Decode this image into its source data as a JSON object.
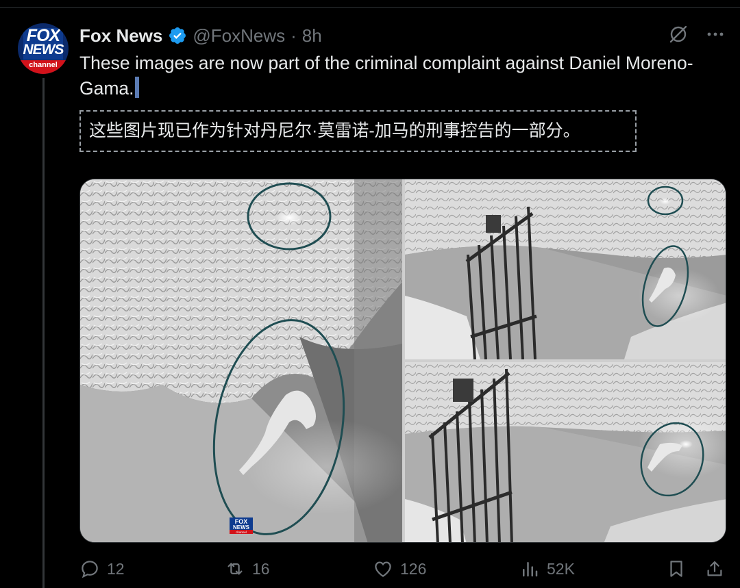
{
  "post": {
    "author_name": "Fox News",
    "handle": "@FoxNews",
    "separator": "·",
    "time": "8h",
    "text": "These images are now part of the criminal complaint against Daniel Moreno-Gama.",
    "translation": "这些图片现已作为针对丹尼尔·莫雷诺-加马的刑事控告的一部分。"
  },
  "avatar": {
    "logo_top": "FOX",
    "logo_bottom": "NEWS",
    "logo_band": "channel"
  },
  "media": {
    "watermark_top": "FOX",
    "watermark_bottom": "NEWS",
    "watermark_band": "channel"
  },
  "actions": {
    "replies": "12",
    "reposts": "16",
    "likes": "126",
    "views": "52K"
  },
  "icons": {
    "verified": "verified-badge-icon",
    "grok": "grok-icon",
    "more": "more-icon",
    "reply": "reply-icon",
    "repost": "repost-icon",
    "like": "like-icon",
    "views": "views-icon",
    "bookmark": "bookmark-icon",
    "share": "share-icon"
  },
  "colors": {
    "background": "#000000",
    "text": "#e7e9ea",
    "muted": "#71767b",
    "verified": "#1d9bf0",
    "fox_red": "#d2121a",
    "fox_blue": "#0e3b8f",
    "highlight_ring": "#1f4d52"
  }
}
